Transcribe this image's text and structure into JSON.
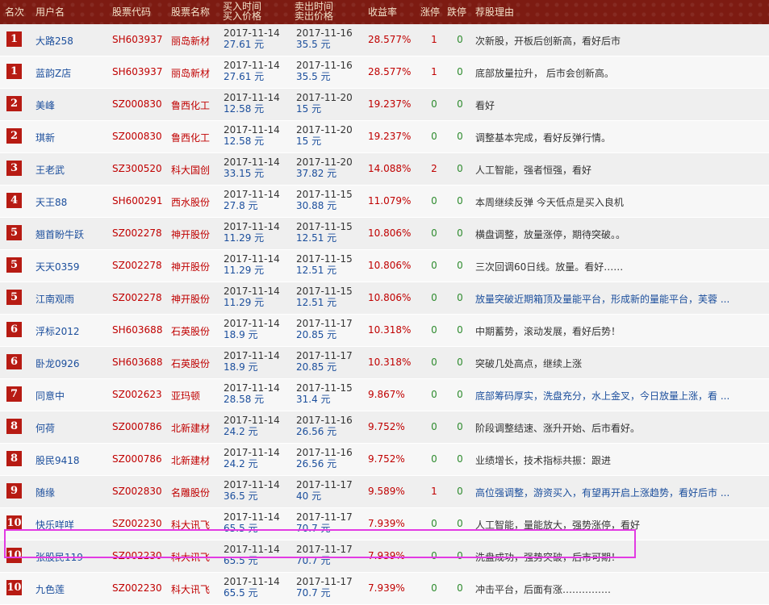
{
  "header": {
    "rank": "名次",
    "user": "用户名",
    "code": "股票代码",
    "name": "股票名称",
    "buy_line1": "买入时间",
    "buy_line2": "买入价格",
    "sell_line1": "卖出时间",
    "sell_line2": "卖出价格",
    "rate": "收益率",
    "limit_up": "涨停",
    "limit_down": "跌停",
    "reason": "荐股理由"
  },
  "rows": [
    {
      "rank": "1",
      "user": "大路258",
      "code": "SH603937",
      "name": "丽岛新材",
      "buy_date": "2017-11-14",
      "buy_price": "27.61 元",
      "sell_date": "2017-11-16",
      "sell_price": "35.5 元",
      "rate": "28.577%",
      "limit_up": "1",
      "limit_down": "0",
      "reason": "次新股，开板后创新高，看好后市"
    },
    {
      "rank": "1",
      "user": "蓝韵Z店",
      "code": "SH603937",
      "name": "丽岛新材",
      "buy_date": "2017-11-14",
      "buy_price": "27.61 元",
      "sell_date": "2017-11-16",
      "sell_price": "35.5 元",
      "rate": "28.577%",
      "limit_up": "1",
      "limit_down": "0",
      "reason": "底部放量拉升， 后市会创新高。"
    },
    {
      "rank": "2",
      "user": "美峰",
      "code": "SZ000830",
      "name": "鲁西化工",
      "buy_date": "2017-11-14",
      "buy_price": "12.58 元",
      "sell_date": "2017-11-20",
      "sell_price": "15 元",
      "rate": "19.237%",
      "limit_up": "0",
      "limit_down": "0",
      "reason": "看好"
    },
    {
      "rank": "2",
      "user": "琪新",
      "code": "SZ000830",
      "name": "鲁西化工",
      "buy_date": "2017-11-14",
      "buy_price": "12.58 元",
      "sell_date": "2017-11-20",
      "sell_price": "15 元",
      "rate": "19.237%",
      "limit_up": "0",
      "limit_down": "0",
      "reason": "调整基本完成，看好反弹行情。"
    },
    {
      "rank": "3",
      "user": "王老武",
      "code": "SZ300520",
      "name": "科大国创",
      "buy_date": "2017-11-14",
      "buy_price": "33.15 元",
      "sell_date": "2017-11-20",
      "sell_price": "37.82 元",
      "rate": "14.088%",
      "limit_up": "2",
      "limit_down": "0",
      "reason": "人工智能，强者恒强，看好"
    },
    {
      "rank": "4",
      "user": "天王88",
      "code": "SH600291",
      "name": "西水股份",
      "buy_date": "2017-11-14",
      "buy_price": "27.8 元",
      "sell_date": "2017-11-15",
      "sell_price": "30.88 元",
      "rate": "11.079%",
      "limit_up": "0",
      "limit_down": "0",
      "reason": "本周继续反弹 今天低点是买入良机"
    },
    {
      "rank": "5",
      "user": "翘首盼牛跃",
      "code": "SZ002278",
      "name": "神开股份",
      "buy_date": "2017-11-14",
      "buy_price": "11.29 元",
      "sell_date": "2017-11-15",
      "sell_price": "12.51 元",
      "rate": "10.806%",
      "limit_up": "0",
      "limit_down": "0",
      "reason": "横盘调整，放量涨停，期待突破。。"
    },
    {
      "rank": "5",
      "user": "天天0359",
      "code": "SZ002278",
      "name": "神开股份",
      "buy_date": "2017-11-14",
      "buy_price": "11.29 元",
      "sell_date": "2017-11-15",
      "sell_price": "12.51 元",
      "rate": "10.806%",
      "limit_up": "0",
      "limit_down": "0",
      "reason": "三次回调60日线。放量。看好……"
    },
    {
      "rank": "5",
      "user": "江南观雨",
      "code": "SZ002278",
      "name": "神开股份",
      "buy_date": "2017-11-14",
      "buy_price": "11.29 元",
      "sell_date": "2017-11-15",
      "sell_price": "12.51 元",
      "rate": "10.806%",
      "limit_up": "0",
      "limit_down": "0",
      "reason": "放量突破近期箱顶及量能平台，形成新的量能平台，芙蓉 ..."
    },
    {
      "rank": "6",
      "user": "浮标2012",
      "code": "SH603688",
      "name": "石英股份",
      "buy_date": "2017-11-14",
      "buy_price": "18.9 元",
      "sell_date": "2017-11-17",
      "sell_price": "20.85 元",
      "rate": "10.318%",
      "limit_up": "0",
      "limit_down": "0",
      "reason": "中期蓄势，滚动发展，看好后势！"
    },
    {
      "rank": "6",
      "user": "卧龙0926",
      "code": "SH603688",
      "name": "石英股份",
      "buy_date": "2017-11-14",
      "buy_price": "18.9 元",
      "sell_date": "2017-11-17",
      "sell_price": "20.85 元",
      "rate": "10.318%",
      "limit_up": "0",
      "limit_down": "0",
      "reason": "突破几处高点，继续上涨"
    },
    {
      "rank": "7",
      "user": "同意中",
      "code": "SZ002623",
      "name": "亚玛顿",
      "buy_date": "2017-11-14",
      "buy_price": "28.58 元",
      "sell_date": "2017-11-15",
      "sell_price": "31.4 元",
      "rate": "9.867%",
      "limit_up": "0",
      "limit_down": "0",
      "reason": "底部筹码厚实，洗盘充分，水上金叉，今日放量上涨，看 ..."
    },
    {
      "rank": "8",
      "user": "何荷",
      "code": "SZ000786",
      "name": "北新建材",
      "buy_date": "2017-11-14",
      "buy_price": "24.2 元",
      "sell_date": "2017-11-16",
      "sell_price": "26.56 元",
      "rate": "9.752%",
      "limit_up": "0",
      "limit_down": "0",
      "reason": "阶段调整结速、涨升开始、后市看好。"
    },
    {
      "rank": "8",
      "user": "股民9418",
      "code": "SZ000786",
      "name": "北新建材",
      "buy_date": "2017-11-14",
      "buy_price": "24.2 元",
      "sell_date": "2017-11-16",
      "sell_price": "26.56 元",
      "rate": "9.752%",
      "limit_up": "0",
      "limit_down": "0",
      "reason": "业绩增长，技术指标共振：跟进"
    },
    {
      "rank": "9",
      "user": "随缘",
      "code": "SZ002830",
      "name": "名雕股份",
      "buy_date": "2017-11-14",
      "buy_price": "36.5 元",
      "sell_date": "2017-11-17",
      "sell_price": "40 元",
      "rate": "9.589%",
      "limit_up": "1",
      "limit_down": "0",
      "reason": "高位强调整，游资买入，有望再开启上涨趋势，看好后市 ..."
    },
    {
      "rank": "10",
      "user": "快乐咩咩",
      "code": "SZ002230",
      "name": "科大讯飞",
      "buy_date": "2017-11-14",
      "buy_price": "65.5 元",
      "sell_date": "2017-11-17",
      "sell_price": "70.7 元",
      "rate": "7.939%",
      "limit_up": "0",
      "limit_down": "0",
      "reason": "人工智能，量能放大，强势涨停，看好"
    },
    {
      "rank": "10",
      "user": "张股民119",
      "code": "SZ002230",
      "name": "科大讯飞",
      "buy_date": "2017-11-14",
      "buy_price": "65.5 元",
      "sell_date": "2017-11-17",
      "sell_price": "70.7 元",
      "rate": "7.939%",
      "limit_up": "0",
      "limit_down": "0",
      "reason": "洗盘成功，强势突破，后市可期！"
    },
    {
      "rank": "10",
      "user": "九色莲",
      "code": "SZ002230",
      "name": "科大讯飞",
      "buy_date": "2017-11-14",
      "buy_price": "65.5 元",
      "sell_date": "2017-11-17",
      "sell_price": "70.7 元",
      "rate": "7.939%",
      "limit_up": "0",
      "limit_down": "0",
      "reason": "冲击平台，后面有涨……………"
    }
  ],
  "colors": {
    "header_bg": "#7d1b12",
    "header_text": "#f3e2c9",
    "rank_badge": "#b71b13",
    "red_text": "#c00000",
    "blue_text": "#1b4e9c",
    "green_text": "#2e8b2e",
    "highlight_border": "#e23be3"
  }
}
